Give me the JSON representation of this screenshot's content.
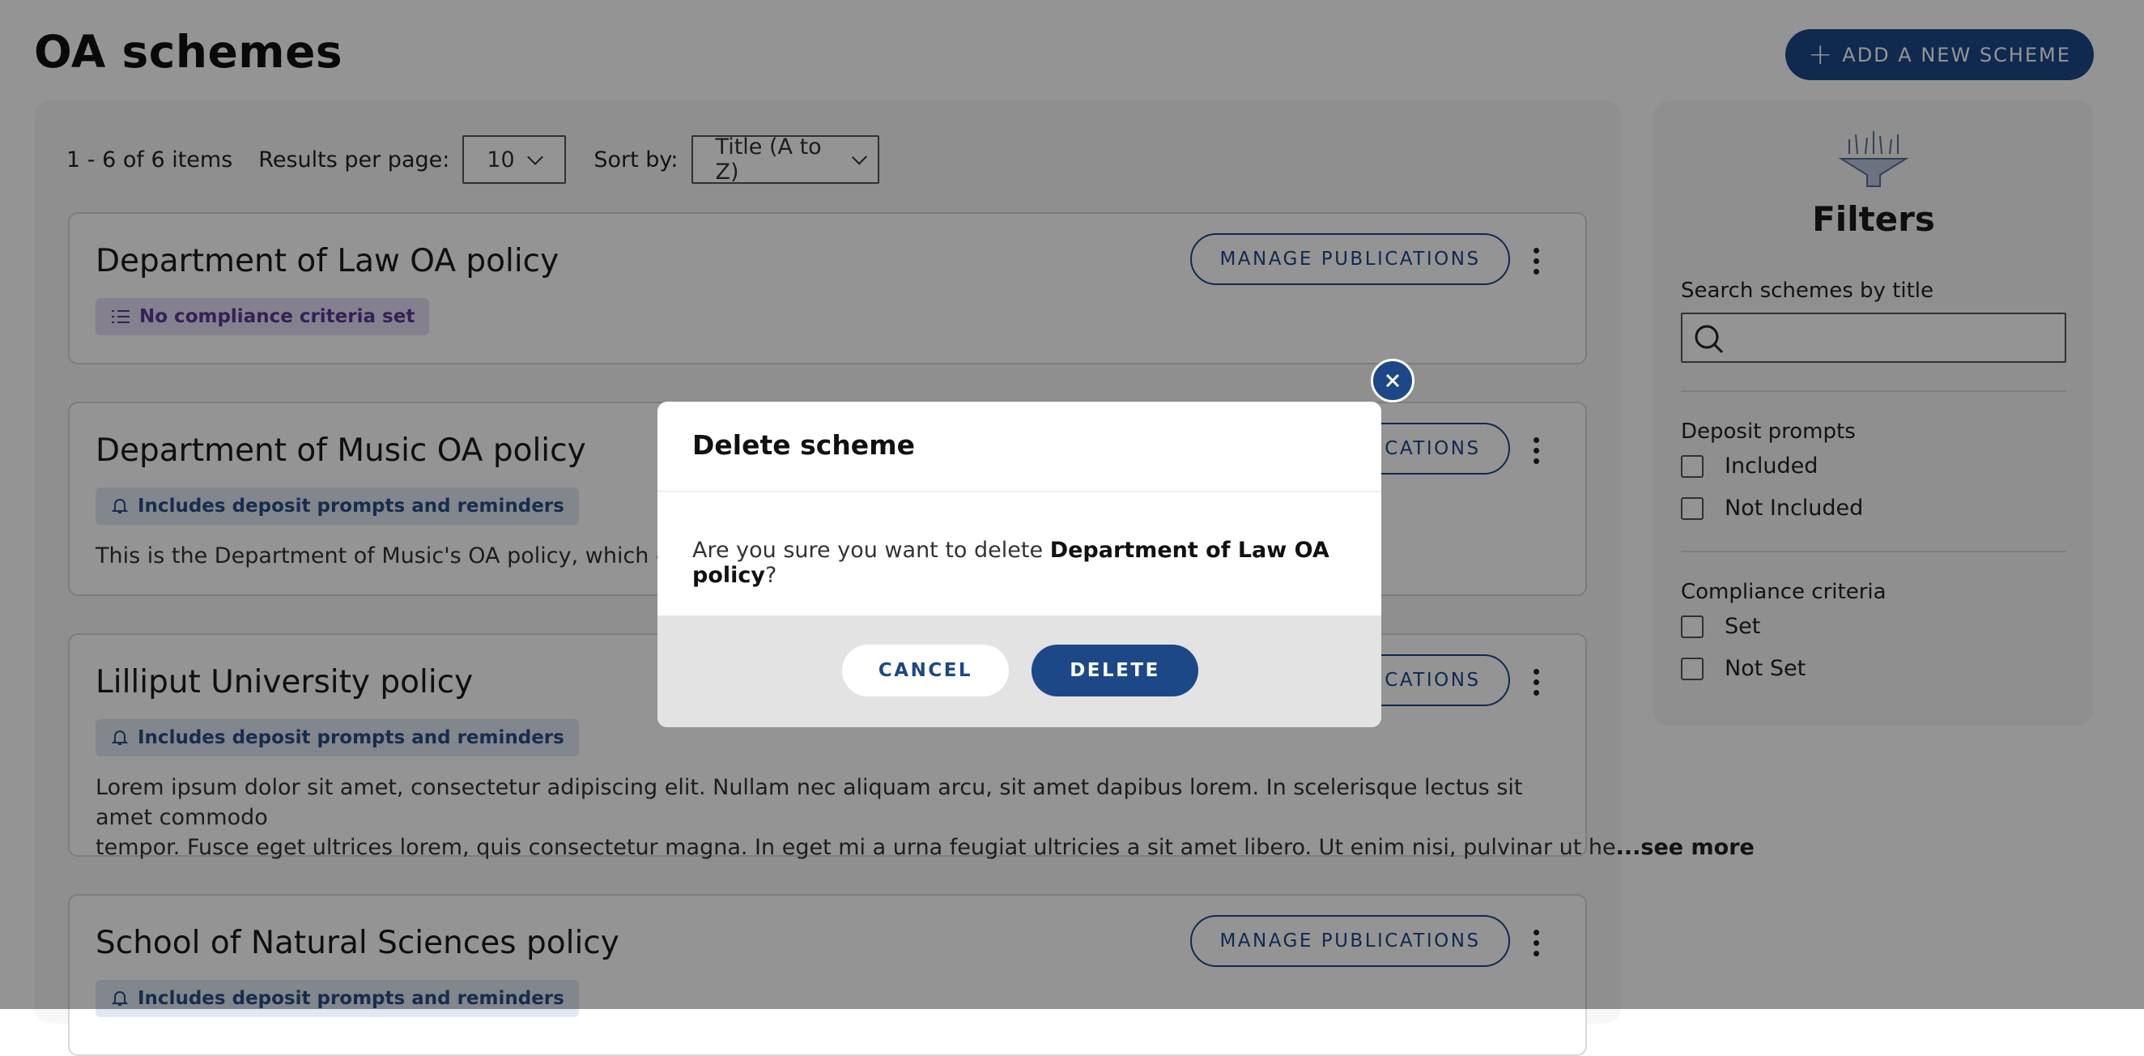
{
  "page": {
    "title": "OA schemes",
    "add_button": "ADD A NEW SCHEME"
  },
  "toolbar": {
    "count": "1 - 6 of 6 items",
    "per_page_label": "Results per page:",
    "per_page_value": "10",
    "sort_label": "Sort by:",
    "sort_value": "Title (A to Z)"
  },
  "cards": [
    {
      "title": "Department of Law OA policy",
      "badge": "No compliance criteria set",
      "button": "MANAGE PUBLICATIONS",
      "description": ""
    },
    {
      "title": "Department of Music OA policy",
      "badge": "Includes deposit prompts and reminders",
      "button": "MANAGE PUBLICATIONS",
      "description": "This is the Department of Music's OA policy, which came"
    },
    {
      "title": "Lilliput University policy",
      "badge": "Includes deposit prompts and reminders",
      "button": "MANAGE PUBLICATIONS",
      "description_line1": "Lorem ipsum dolor sit amet, consectetur adipiscing elit. Nullam nec aliquam arcu, sit amet dapibus lorem. In scelerisque lectus sit amet commodo",
      "description_line2": "tempor. Fusce eget ultrices lorem, quis consectetur magna. In eget mi a urna feugiat ultricies a sit amet libero. Ut enim nisi, pulvinar ut he",
      "see_more": "...see more"
    },
    {
      "title": "School of Natural Sciences policy",
      "badge": "Includes deposit prompts and reminders",
      "button": "MANAGE PUBLICATIONS",
      "description": ""
    }
  ],
  "filters": {
    "title": "Filters",
    "search_label": "Search schemes by title",
    "search_value": "",
    "deposit_label": "Deposit prompts",
    "deposit_options": [
      "Included",
      "Not Included"
    ],
    "compliance_label": "Compliance criteria",
    "compliance_options": [
      "Set",
      "Not Set"
    ]
  },
  "modal": {
    "title": "Delete scheme",
    "body_prefix": "Are you sure you want to delete ",
    "body_name": "Department of Law OA policy",
    "body_suffix": "?",
    "cancel": "CANCEL",
    "delete": "DELETE"
  },
  "colors": {
    "primary": "#1d4887",
    "overlay": "rgba(0,0,0,0.42)",
    "purple_badge": "#e4ddf4",
    "blue_badge": "#e1e8f3"
  },
  "icons": {
    "add": "plus-icon",
    "search": "search-icon",
    "filter": "filter-funnel-icon",
    "close": "close-icon",
    "list": "list-icon",
    "bell": "bell-icon",
    "more": "kebab-icon",
    "chevron": "chevron-down-icon"
  }
}
